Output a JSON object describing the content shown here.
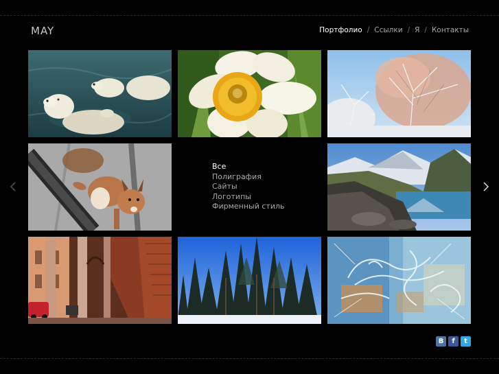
{
  "site": {
    "logo": "MAY"
  },
  "nav": {
    "items": [
      {
        "label": "Портфолио",
        "active": true
      },
      {
        "label": "Ссылки",
        "active": false
      },
      {
        "label": "Я",
        "active": false
      },
      {
        "label": "Контакты",
        "active": false
      }
    ],
    "separator": "/"
  },
  "filters": {
    "items": [
      {
        "label": "Все",
        "active": true
      },
      {
        "label": "Полиграфия",
        "active": false
      },
      {
        "label": "Сайты",
        "active": false
      },
      {
        "label": "Логотипы",
        "active": false
      },
      {
        "label": "Фирменный стиль",
        "active": false
      }
    ]
  },
  "gallery": {
    "tiles": [
      {
        "subject": "polar-bears"
      },
      {
        "subject": "daffodil"
      },
      {
        "subject": "frosted-birch"
      },
      {
        "subject": "squirrel"
      },
      {
        "subject": "mountain-lake"
      },
      {
        "subject": "arcade-street"
      },
      {
        "subject": "snowy-pine-forest"
      },
      {
        "subject": "frost-pattern"
      }
    ]
  },
  "pager": {
    "prev_icon": "chevron-left-icon",
    "next_icon": "chevron-right-icon"
  },
  "social": {
    "vk_glyph": "B",
    "fb_glyph": "f",
    "tw_glyph": "t"
  },
  "colors": {
    "background": "#000000",
    "text_active": "#ffffff",
    "text_muted": "#a8a8a8",
    "vk": "#4c75a3",
    "facebook": "#3b5998",
    "twitter": "#2fa9e0"
  }
}
